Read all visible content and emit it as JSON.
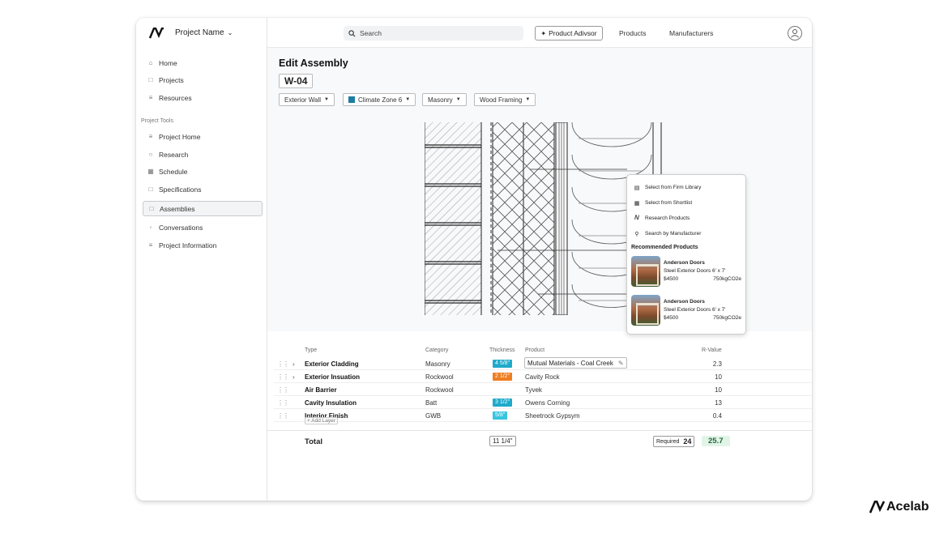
{
  "sidebar": {
    "project_name": "Project Name",
    "nav": [
      {
        "label": "Home",
        "icon": "home-icon"
      },
      {
        "label": "Projects",
        "icon": "note-icon"
      },
      {
        "label": "Resources",
        "icon": "list-icon"
      }
    ],
    "section_label": "Project Tools",
    "tools": [
      {
        "label": "Project Home",
        "icon": "list-icon"
      },
      {
        "label": "Research",
        "icon": "search-icon"
      },
      {
        "label": "Schedule",
        "icon": "calendar-icon"
      },
      {
        "label": "Specifications",
        "icon": "note-icon"
      },
      {
        "label": "Assemblies",
        "icon": "note-icon",
        "active": true
      },
      {
        "label": "Conversations",
        "icon": "chat-icon"
      },
      {
        "label": "Project Information",
        "icon": "list-icon"
      }
    ]
  },
  "topbar": {
    "search_placeholder": "Search",
    "advisor_label": "Product Adivsor",
    "products_label": "Products",
    "manufacturers_label": "Manufacturers"
  },
  "assembly": {
    "title": "Edit Assembly",
    "code": "W-04",
    "filters": [
      "Exterior Wall",
      "Climate Zone 6",
      "Masonry",
      "Wood Framing"
    ],
    "climate_color": "#1d7da3"
  },
  "popup": {
    "items": [
      {
        "label": "Select from Firm Library",
        "icon": "library-icon"
      },
      {
        "label": "Select from Shortlist",
        "icon": "shortlist-icon"
      },
      {
        "label": "Research Products",
        "icon": "brand-icon"
      },
      {
        "label": "Search by Manufacturer",
        "icon": "search-icon"
      }
    ],
    "recommended_heading": "Recommended Products",
    "products": [
      {
        "name": "Anderson Doors",
        "desc": "Steel Exterior Doors 6' x 7'",
        "price": "$4500",
        "carbon": "750kgCO2e"
      },
      {
        "name": "Anderson Doors",
        "desc": "Steel Exterior Doors 6' x 7'",
        "price": "$4500",
        "carbon": "750kgCO2e"
      }
    ]
  },
  "table": {
    "headers": {
      "type": "Type",
      "category": "Category",
      "thickness": "Thickness",
      "product": "Product",
      "rvalue": "R-Value"
    },
    "rows": [
      {
        "type": "Exterior Cladding",
        "category": "Masonry",
        "thickness": "4 5/8\"",
        "thk_color": "#1eaacb",
        "product": "Mutual Materials - Coal Creek",
        "rvalue": "2.3",
        "expandable": true,
        "editing": true
      },
      {
        "type": "Exterior Insuation",
        "category": "Rockwool",
        "thickness": "2 1/2\"",
        "thk_color": "#ef7d22",
        "product": "Cavity Rock",
        "rvalue": "10",
        "expandable": true,
        "editing": false
      },
      {
        "type": "Air Barrier",
        "category": "Rockwool",
        "thickness": "",
        "thk_color": "",
        "product": "Tyvek",
        "rvalue": "10",
        "expandable": false,
        "editing": false
      },
      {
        "type": "Cavity Insulation",
        "category": "Batt",
        "thickness": "3 1/2\"",
        "thk_color": "#1eaacb",
        "product": "Owens Corning",
        "rvalue": "13",
        "expandable": false,
        "editing": false
      },
      {
        "type": "Interior Finish",
        "category": "GWB",
        "thickness": "5/8\"",
        "thk_color": "#38c4df",
        "product": "Sheetrock Gypsym",
        "rvalue": "0.4",
        "expandable": false,
        "editing": false
      }
    ],
    "add_layer_label": "+ Add Layer",
    "total_label": "Total",
    "total_thickness": "11 1/4\"",
    "required_label": "Required",
    "required_value": "24",
    "total_rvalue": "25.7"
  },
  "brand": "Acelab"
}
